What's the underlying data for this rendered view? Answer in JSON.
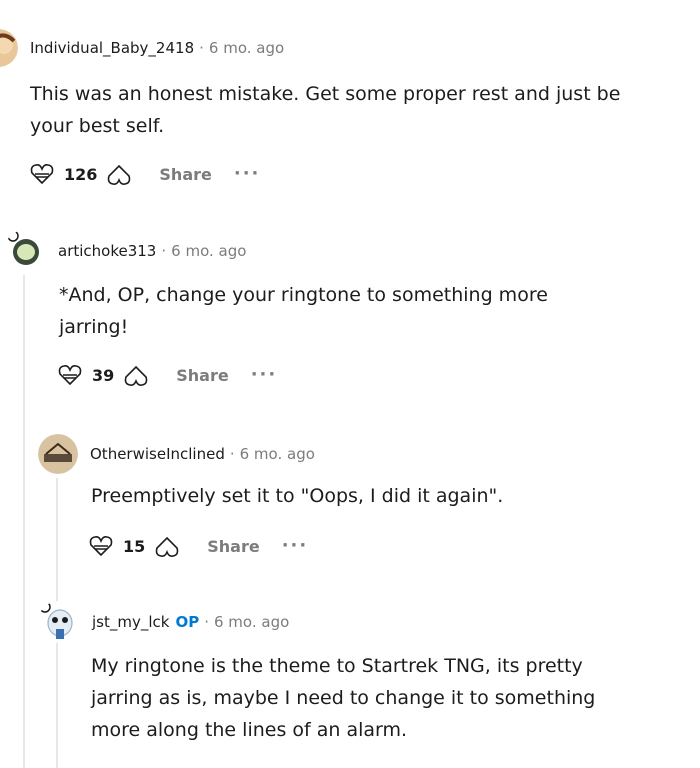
{
  "comments": [
    {
      "username": "Individual_Baby_2418",
      "time": "6 mo. ago",
      "body_lines": [
        "This was an honest mistake. Get some proper rest and just be",
        "your best self."
      ],
      "votes": "126",
      "share": "Share",
      "more": "···"
    },
    {
      "username": "artichoke313",
      "time": "6 mo. ago",
      "body_lines": [
        "*And, OP, change your ringtone to something more",
        "jarring!"
      ],
      "votes": "39",
      "share": "Share",
      "more": "···"
    },
    {
      "username": "OtherwiseInclined",
      "time": "6 mo. ago",
      "body_lines": [
        "Preemptively set it to \"Oops, I did it again\"."
      ],
      "votes": "15",
      "share": "Share",
      "more": "···"
    },
    {
      "username": "jst_my_lck",
      "op_badge": "OP",
      "time": "6 mo. ago",
      "body_lines": [
        "My ringtone is the theme to Startrek TNG, its pretty",
        "jarring as is, maybe I need to change it to something",
        "more along the lines of an alarm."
      ]
    }
  ],
  "separator": "·",
  "icons": {
    "upvote": "upvote-icon",
    "downvote": "downvote-icon",
    "more": "more-options-icon"
  }
}
